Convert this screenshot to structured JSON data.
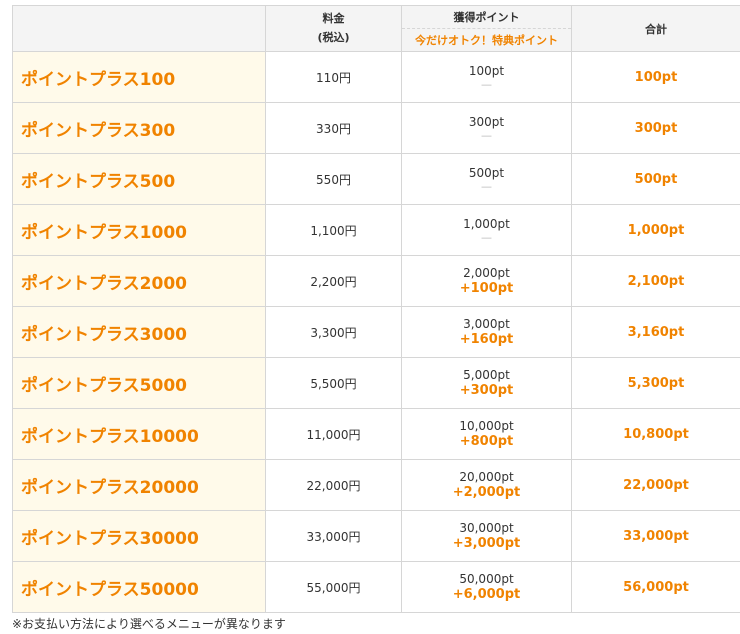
{
  "header": {
    "price_line1": "料金",
    "price_line2": "(税込)",
    "points_title": "獲得ポイント",
    "points_sub": "今だけオトク！特典ポイント",
    "total": "合計"
  },
  "rows": [
    {
      "name": "ポイントプラス100",
      "price": "110円",
      "base": "100pt",
      "bonus": "",
      "total": "100pt"
    },
    {
      "name": "ポイントプラス300",
      "price": "330円",
      "base": "300pt",
      "bonus": "",
      "total": "300pt"
    },
    {
      "name": "ポイントプラス500",
      "price": "550円",
      "base": "500pt",
      "bonus": "",
      "total": "500pt"
    },
    {
      "name": "ポイントプラス1000",
      "price": "1,100円",
      "base": "1,000pt",
      "bonus": "",
      "total": "1,000pt"
    },
    {
      "name": "ポイントプラス2000",
      "price": "2,200円",
      "base": "2,000pt",
      "bonus": "+100pt",
      "total": "2,100pt"
    },
    {
      "name": "ポイントプラス3000",
      "price": "3,300円",
      "base": "3,000pt",
      "bonus": "+160pt",
      "total": "3,160pt"
    },
    {
      "name": "ポイントプラス5000",
      "price": "5,500円",
      "base": "5,000pt",
      "bonus": "+300pt",
      "total": "5,300pt"
    },
    {
      "name": "ポイントプラス10000",
      "price": "11,000円",
      "base": "10,000pt",
      "bonus": "+800pt",
      "total": "10,800pt"
    },
    {
      "name": "ポイントプラス20000",
      "price": "22,000円",
      "base": "20,000pt",
      "bonus": "+2,000pt",
      "total": "22,000pt"
    },
    {
      "name": "ポイントプラス30000",
      "price": "33,000円",
      "base": "30,000pt",
      "bonus": "+3,000pt",
      "total": "33,000pt"
    },
    {
      "name": "ポイントプラス50000",
      "price": "55,000円",
      "base": "50,000pt",
      "bonus": "+6,000pt",
      "total": "56,000pt"
    }
  ],
  "no_bonus_mark": "—",
  "note": "※お支払い方法により選べるメニューが異なります",
  "colors": {
    "accent": "#f08300",
    "name_bg": "#fffaea",
    "header_bg": "#f4f4f4",
    "border": "#d6d6d6"
  }
}
